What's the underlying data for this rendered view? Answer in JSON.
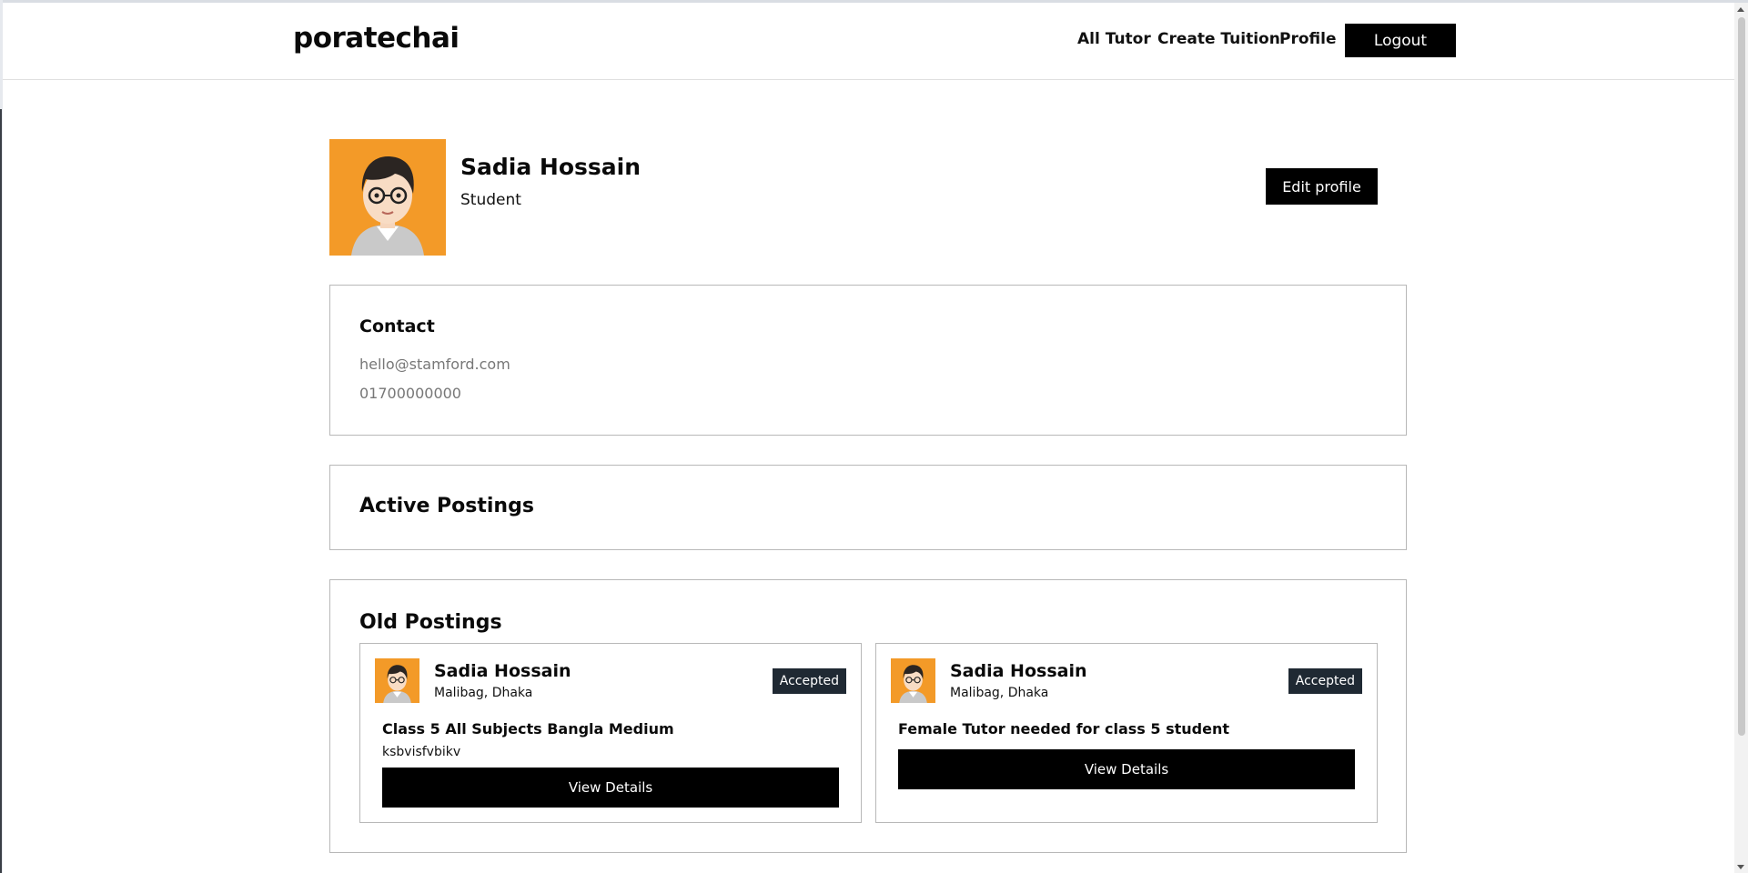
{
  "navbar": {
    "brand": "poratechai",
    "links": [
      "All Tutor",
      "Create Tuition",
      "Profile"
    ],
    "logout_label": "Logout"
  },
  "profile": {
    "name": "Sadia Hossain",
    "role": "Student",
    "edit_label": "Edit profile",
    "avatar_bg": "#f39a28"
  },
  "contact": {
    "title": "Contact",
    "email": "hello@stamford.com",
    "phone": "01700000000"
  },
  "active_postings": {
    "title": "Active Postings"
  },
  "old_postings": {
    "title": "Old Postings",
    "items": [
      {
        "name": "Sadia Hossain",
        "location": "Malibag, Dhaka",
        "status": "Accepted",
        "title": "Class 5 All Subjects Bangla Medium",
        "description": "ksbvisfvbikv",
        "button": "View Details"
      },
      {
        "name": "Sadia Hossain",
        "location": "Malibag, Dhaka",
        "status": "Accepted",
        "title": "Female Tutor needed for class 5 student",
        "button": "View Details"
      }
    ]
  }
}
